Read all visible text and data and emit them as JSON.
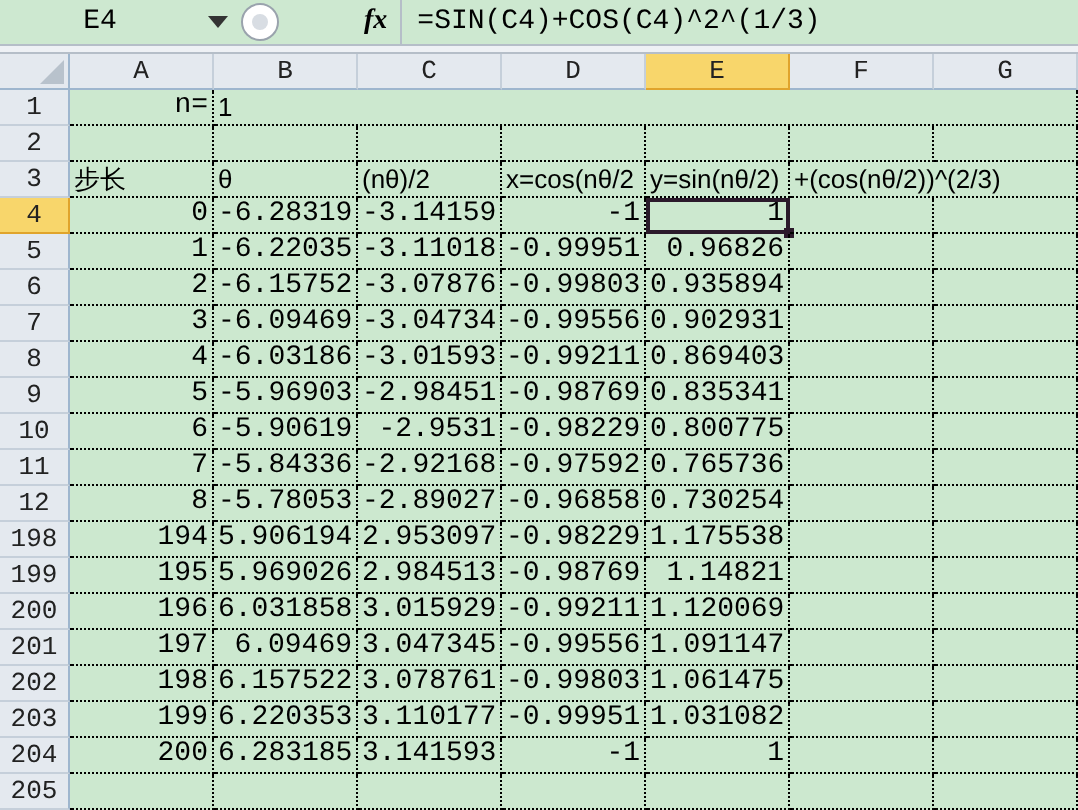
{
  "formula_bar": {
    "name_box": "E4",
    "fx": "fx",
    "formula": "=SIN(C4)+COS(C4)^2^(1/3)"
  },
  "columns": [
    {
      "label": "A",
      "selected": false
    },
    {
      "label": "B",
      "selected": false
    },
    {
      "label": "C",
      "selected": false
    },
    {
      "label": "D",
      "selected": false
    },
    {
      "label": "E",
      "selected": true
    },
    {
      "label": "F",
      "selected": false
    },
    {
      "label": "G",
      "selected": false
    }
  ],
  "rows": [
    {
      "header": "1",
      "selected": false,
      "cells": [
        {
          "kind": "label",
          "text": "n="
        },
        {
          "kind": "text",
          "text": "1"
        },
        {
          "kind": "empty"
        },
        {
          "kind": "empty"
        },
        {
          "kind": "empty"
        },
        {
          "kind": "empty"
        },
        {
          "kind": "empty"
        }
      ]
    },
    {
      "header": "2",
      "selected": false,
      "cells": [
        {
          "kind": "empty"
        },
        {
          "kind": "empty"
        },
        {
          "kind": "empty"
        },
        {
          "kind": "empty"
        },
        {
          "kind": "empty"
        },
        {
          "kind": "empty"
        },
        {
          "kind": "empty"
        }
      ]
    },
    {
      "header": "3",
      "selected": false,
      "cells": [
        {
          "kind": "text",
          "text": "步长"
        },
        {
          "kind": "text",
          "text": "θ"
        },
        {
          "kind": "text",
          "text": "(nθ)/2"
        },
        {
          "kind": "text",
          "text": "x=cos(nθ/2"
        },
        {
          "kind": "text",
          "text": "y=sin(nθ/2)"
        },
        {
          "kind": "text",
          "text": "+(cos(nθ/2))^(2/3)"
        },
        {
          "kind": "empty"
        }
      ]
    },
    {
      "header": "4",
      "selected": true,
      "cells": [
        {
          "kind": "number",
          "text": "0"
        },
        {
          "kind": "number",
          "text": "-6.28319"
        },
        {
          "kind": "number",
          "text": "-3.14159"
        },
        {
          "kind": "number",
          "text": "-1"
        },
        {
          "kind": "number",
          "text": "1",
          "selected": true
        },
        {
          "kind": "empty"
        },
        {
          "kind": "empty"
        }
      ]
    },
    {
      "header": "5",
      "selected": false,
      "cells": [
        {
          "kind": "number",
          "text": "1"
        },
        {
          "kind": "number",
          "text": "-6.22035"
        },
        {
          "kind": "number",
          "text": "-3.11018"
        },
        {
          "kind": "number",
          "text": "-0.99951"
        },
        {
          "kind": "number",
          "text": "0.96826"
        },
        {
          "kind": "empty"
        },
        {
          "kind": "empty"
        }
      ]
    },
    {
      "header": "6",
      "selected": false,
      "cells": [
        {
          "kind": "number",
          "text": "2"
        },
        {
          "kind": "number",
          "text": "-6.15752"
        },
        {
          "kind": "number",
          "text": "-3.07876"
        },
        {
          "kind": "number",
          "text": "-0.99803"
        },
        {
          "kind": "number",
          "text": "0.935894"
        },
        {
          "kind": "empty"
        },
        {
          "kind": "empty"
        }
      ]
    },
    {
      "header": "7",
      "selected": false,
      "cells": [
        {
          "kind": "number",
          "text": "3"
        },
        {
          "kind": "number",
          "text": "-6.09469"
        },
        {
          "kind": "number",
          "text": "-3.04734"
        },
        {
          "kind": "number",
          "text": "-0.99556"
        },
        {
          "kind": "number",
          "text": "0.902931"
        },
        {
          "kind": "empty"
        },
        {
          "kind": "empty"
        }
      ]
    },
    {
      "header": "8",
      "selected": false,
      "cells": [
        {
          "kind": "number",
          "text": "4"
        },
        {
          "kind": "number",
          "text": "-6.03186"
        },
        {
          "kind": "number",
          "text": "-3.01593"
        },
        {
          "kind": "number",
          "text": "-0.99211"
        },
        {
          "kind": "number",
          "text": "0.869403"
        },
        {
          "kind": "empty"
        },
        {
          "kind": "empty"
        }
      ]
    },
    {
      "header": "9",
      "selected": false,
      "cells": [
        {
          "kind": "number",
          "text": "5"
        },
        {
          "kind": "number",
          "text": "-5.96903"
        },
        {
          "kind": "number",
          "text": "-2.98451"
        },
        {
          "kind": "number",
          "text": "-0.98769"
        },
        {
          "kind": "number",
          "text": "0.835341"
        },
        {
          "kind": "empty"
        },
        {
          "kind": "empty"
        }
      ]
    },
    {
      "header": "10",
      "selected": false,
      "cells": [
        {
          "kind": "number",
          "text": "6"
        },
        {
          "kind": "number",
          "text": "-5.90619"
        },
        {
          "kind": "number",
          "text": "-2.9531"
        },
        {
          "kind": "number",
          "text": "-0.98229"
        },
        {
          "kind": "number",
          "text": "0.800775"
        },
        {
          "kind": "empty"
        },
        {
          "kind": "empty"
        }
      ]
    },
    {
      "header": "11",
      "selected": false,
      "cells": [
        {
          "kind": "number",
          "text": "7"
        },
        {
          "kind": "number",
          "text": "-5.84336"
        },
        {
          "kind": "number",
          "text": "-2.92168"
        },
        {
          "kind": "number",
          "text": "-0.97592"
        },
        {
          "kind": "number",
          "text": "0.765736"
        },
        {
          "kind": "empty"
        },
        {
          "kind": "empty"
        }
      ]
    },
    {
      "header": "12",
      "selected": false,
      "cells": [
        {
          "kind": "number",
          "text": "8"
        },
        {
          "kind": "number",
          "text": "-5.78053"
        },
        {
          "kind": "number",
          "text": "-2.89027"
        },
        {
          "kind": "number",
          "text": "-0.96858"
        },
        {
          "kind": "number",
          "text": "0.730254"
        },
        {
          "kind": "empty"
        },
        {
          "kind": "empty"
        }
      ]
    },
    {
      "header": "198",
      "selected": false,
      "cells": [
        {
          "kind": "number",
          "text": "194"
        },
        {
          "kind": "number",
          "text": "5.906194"
        },
        {
          "kind": "number",
          "text": "2.953097"
        },
        {
          "kind": "number",
          "text": "-0.98229"
        },
        {
          "kind": "number",
          "text": "1.175538"
        },
        {
          "kind": "empty"
        },
        {
          "kind": "empty"
        }
      ]
    },
    {
      "header": "199",
      "selected": false,
      "cells": [
        {
          "kind": "number",
          "text": "195"
        },
        {
          "kind": "number",
          "text": "5.969026"
        },
        {
          "kind": "number",
          "text": "2.984513"
        },
        {
          "kind": "number",
          "text": "-0.98769"
        },
        {
          "kind": "number",
          "text": "1.14821"
        },
        {
          "kind": "empty"
        },
        {
          "kind": "empty"
        }
      ]
    },
    {
      "header": "200",
      "selected": false,
      "cells": [
        {
          "kind": "number",
          "text": "196"
        },
        {
          "kind": "number",
          "text": "6.031858"
        },
        {
          "kind": "number",
          "text": "3.015929"
        },
        {
          "kind": "number",
          "text": "-0.99211"
        },
        {
          "kind": "number",
          "text": "1.120069"
        },
        {
          "kind": "empty"
        },
        {
          "kind": "empty"
        }
      ]
    },
    {
      "header": "201",
      "selected": false,
      "cells": [
        {
          "kind": "number",
          "text": "197"
        },
        {
          "kind": "number",
          "text": "6.09469"
        },
        {
          "kind": "number",
          "text": "3.047345"
        },
        {
          "kind": "number",
          "text": "-0.99556"
        },
        {
          "kind": "number",
          "text": "1.091147"
        },
        {
          "kind": "empty"
        },
        {
          "kind": "empty"
        }
      ]
    },
    {
      "header": "202",
      "selected": false,
      "cells": [
        {
          "kind": "number",
          "text": "198"
        },
        {
          "kind": "number",
          "text": "6.157522"
        },
        {
          "kind": "number",
          "text": "3.078761"
        },
        {
          "kind": "number",
          "text": "-0.99803"
        },
        {
          "kind": "number",
          "text": "1.061475"
        },
        {
          "kind": "empty"
        },
        {
          "kind": "empty"
        }
      ]
    },
    {
      "header": "203",
      "selected": false,
      "cells": [
        {
          "kind": "number",
          "text": "199"
        },
        {
          "kind": "number",
          "text": "6.220353"
        },
        {
          "kind": "number",
          "text": "3.110177"
        },
        {
          "kind": "number",
          "text": "-0.99951"
        },
        {
          "kind": "number",
          "text": "1.031082"
        },
        {
          "kind": "empty"
        },
        {
          "kind": "empty"
        }
      ]
    },
    {
      "header": "204",
      "selected": false,
      "cells": [
        {
          "kind": "number",
          "text": "200"
        },
        {
          "kind": "number",
          "text": "6.283185"
        },
        {
          "kind": "number",
          "text": "3.141593"
        },
        {
          "kind": "number",
          "text": "-1"
        },
        {
          "kind": "number",
          "text": "1"
        },
        {
          "kind": "empty"
        },
        {
          "kind": "empty"
        }
      ]
    },
    {
      "header": "205",
      "selected": false,
      "cells": [
        {
          "kind": "empty"
        },
        {
          "kind": "empty"
        },
        {
          "kind": "empty"
        },
        {
          "kind": "empty"
        },
        {
          "kind": "empty"
        },
        {
          "kind": "empty"
        },
        {
          "kind": "empty"
        }
      ]
    }
  ]
}
